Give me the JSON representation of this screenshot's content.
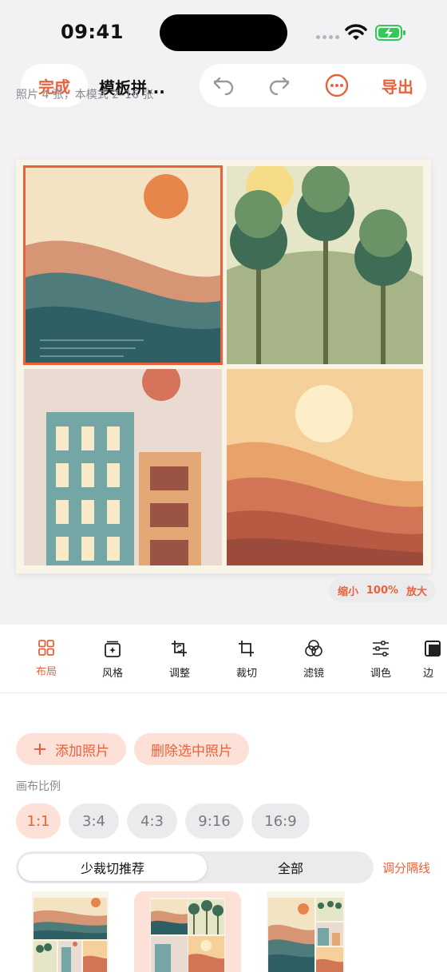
{
  "status": {
    "time": "09:41"
  },
  "header": {
    "done_label": "完成",
    "title": "模板拼...",
    "export_label": "导出"
  },
  "zoom": {
    "out_label": "缩小",
    "level": "100%",
    "in_label": "放大"
  },
  "tools": [
    {
      "label": "布局",
      "icon": "layout-grid-icon",
      "active": true
    },
    {
      "label": "风格",
      "icon": "style-icon"
    },
    {
      "label": "调整",
      "icon": "adjust-crop-icon"
    },
    {
      "label": "裁切",
      "icon": "crop-icon"
    },
    {
      "label": "滤镜",
      "icon": "filter-icon"
    },
    {
      "label": "调色",
      "icon": "color-sliders-icon"
    },
    {
      "label": "边",
      "icon": "border-icon"
    }
  ],
  "photos": {
    "info": "照片 4 张，本模式 2–16 张",
    "add_label": "添加照片",
    "delete_label": "删除选中照片"
  },
  "ratio": {
    "label": "画布比例",
    "options": [
      "1:1",
      "3:4",
      "4:3",
      "9:16",
      "16:9"
    ],
    "selected": "1:1"
  },
  "filter": {
    "tabs": [
      "少裁切推荐",
      "全部"
    ],
    "active": "少裁切推荐",
    "divider_label": "调分隔线"
  },
  "colors": {
    "accent": "#e8613a",
    "accent_soft": "#fde1d8",
    "background": "#f2f2f4"
  }
}
